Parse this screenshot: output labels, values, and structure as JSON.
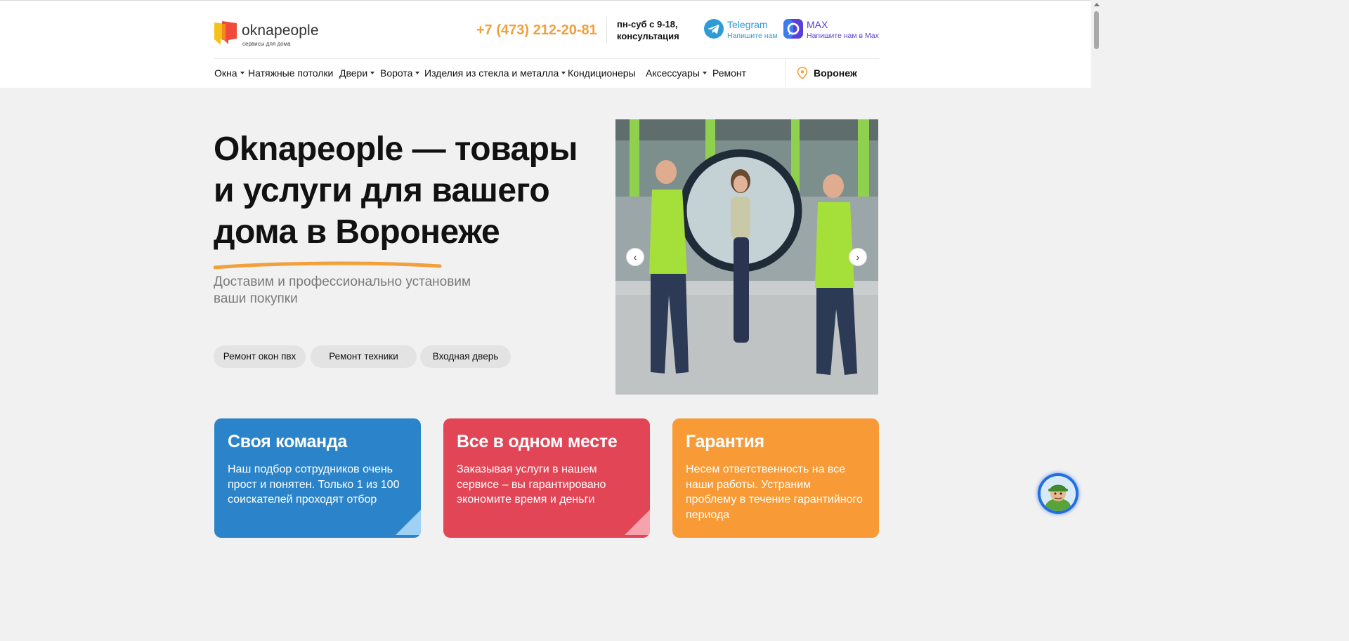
{
  "header": {
    "logo_name": "oknapeople",
    "logo_tag": "сервисы для дома",
    "phone": "+7 (473) 212-20-81",
    "hours_line1": "пн-суб с 9-18,",
    "hours_line2": "консультация",
    "telegram_title": "Telegram",
    "telegram_sub": "Напишите нам",
    "max_title": "MAX",
    "max_sub": "Напишите нам в Max"
  },
  "nav": {
    "items": [
      {
        "label": "Окна",
        "dropdown": true
      },
      {
        "label": "Натяжные потолки",
        "dropdown": false
      },
      {
        "label": "Двери",
        "dropdown": true
      },
      {
        "label": "Ворота",
        "dropdown": true
      },
      {
        "label": "Изделия из стекла и металла",
        "dropdown": true
      },
      {
        "label": "Кондиционеры",
        "dropdown": false
      },
      {
        "label": "Аксессуары",
        "dropdown": true
      },
      {
        "label": "Ремонт",
        "dropdown": false
      }
    ],
    "city": "Воронеж"
  },
  "hero": {
    "title_line1": "Oknapeople — товары",
    "title_line2": "и услуги для вашего",
    "title_line3": "дома в Воронеже",
    "subtitle_line1": "Доставим и профессионально установим",
    "subtitle_line2": "ваши покупки",
    "chips": [
      "Ремонт окон пвх",
      "Ремонт техники",
      "Входная дверь"
    ],
    "slider_prev": "‹",
    "slider_next": "›"
  },
  "cards": [
    {
      "title": "Своя команда",
      "text": "Наш подбор сотрудников очень прост и понятен. Только 1 из 100 соискателей проходят отбор"
    },
    {
      "title": "Все в одном месте",
      "text": "Заказывая услуги в нашем сервисе – вы гарантировано экономите время и деньги"
    },
    {
      "title": "Гарантия",
      "text": "Несем ответственность на все наши работы. Устраним проблему в течение гарантийного периода"
    }
  ],
  "colors": {
    "accent_orange": "#f2a03c",
    "card_blue": "#2b84c9",
    "card_red": "#e14556",
    "card_orange": "#f89a35",
    "telegram": "#2f9bd6",
    "max": "#5a3fd8"
  },
  "icons": {
    "telegram": "telegram-icon",
    "max": "max-icon",
    "city": "location-pin-icon",
    "chat": "chat-assistant-icon"
  }
}
